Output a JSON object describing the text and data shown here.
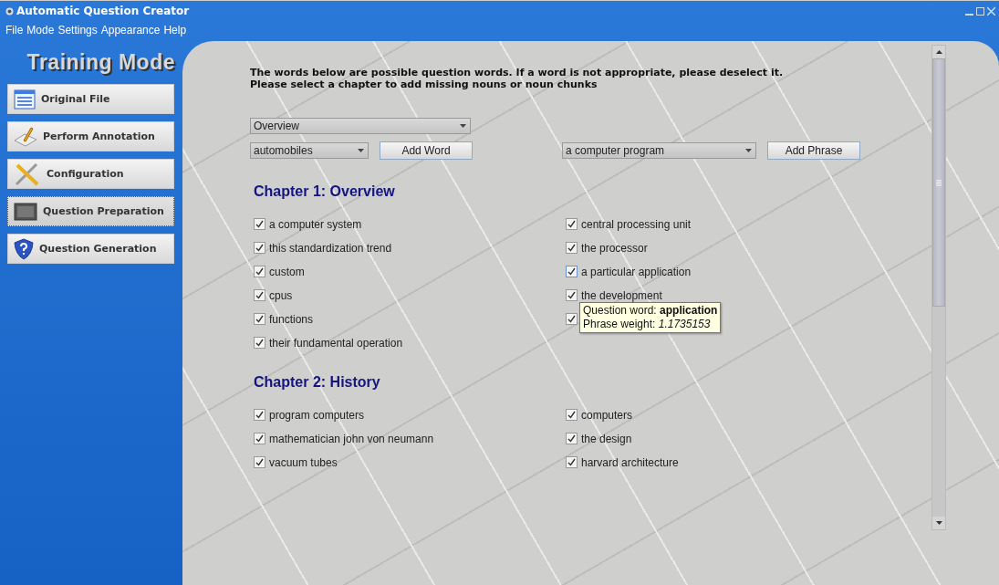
{
  "window": {
    "title": "Automatic Question Creator"
  },
  "menu": [
    "File",
    "Mode",
    "Settings",
    "Appearance",
    "Help"
  ],
  "sidebar": {
    "title": "Training Mode",
    "items": [
      {
        "label": "Original File",
        "selected": false
      },
      {
        "label": "Perform Annotation",
        "selected": false
      },
      {
        "label": "Configuration",
        "selected": false
      },
      {
        "label": "Question Preparation",
        "selected": true
      },
      {
        "label": "Question Generation",
        "selected": false
      }
    ]
  },
  "instructions": [
    "The words below are possible question words. If a word is not appropriate, please deselect it.",
    "Please select a chapter to add missing nouns or noun chunks"
  ],
  "chapter_select": {
    "value": "Overview"
  },
  "word_select": {
    "value": "automobiles"
  },
  "add_word_button": "Add Word",
  "phrase_select": {
    "value": "a computer program"
  },
  "add_phrase_button": "Add Phrase",
  "chapters": [
    {
      "title": "Chapter 1: Overview",
      "left": [
        {
          "label": "a computer system",
          "checked": true
        },
        {
          "label": "this standardization trend",
          "checked": true
        },
        {
          "label": "custom",
          "checked": true
        },
        {
          "label": "cpus",
          "checked": true
        },
        {
          "label": "functions",
          "checked": true
        },
        {
          "label": "their fundamental operation",
          "checked": true
        }
      ],
      "right": [
        {
          "label": "central processing unit",
          "checked": true
        },
        {
          "label": "the processor",
          "checked": true
        },
        {
          "label": "a particular application",
          "checked": true,
          "focused": true
        },
        {
          "label": "the development",
          "checked": true
        },
        {
          "checked": true
        }
      ]
    },
    {
      "title": "Chapter 2: History",
      "left": [
        {
          "label": "program computers",
          "checked": true
        },
        {
          "label": "mathematician john von neumann",
          "checked": true
        },
        {
          "label": "vacuum tubes",
          "checked": true
        }
      ],
      "right": [
        {
          "label": "computers",
          "checked": true
        },
        {
          "label": "the design",
          "checked": true
        },
        {
          "label": "harvard architecture",
          "checked": true
        }
      ]
    }
  ],
  "tooltip": {
    "lines": [
      "Question word: **application**",
      "Phrase weight: *1.1735153*"
    ]
  }
}
